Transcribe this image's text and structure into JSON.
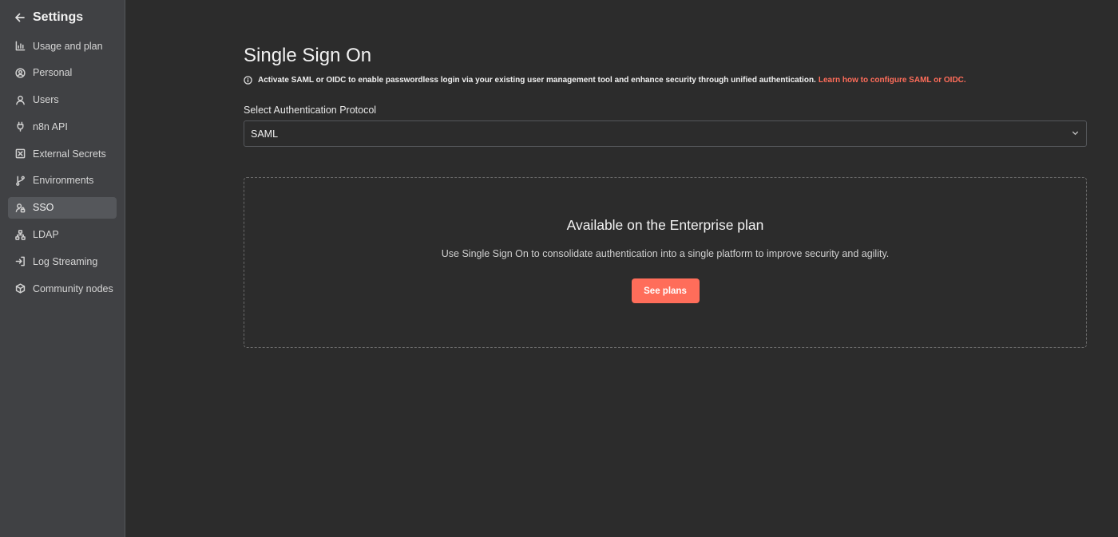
{
  "sidebar": {
    "title": "Settings",
    "items": [
      {
        "label": "Usage and plan",
        "icon": "chart-icon"
      },
      {
        "label": "Personal",
        "icon": "user-circle-icon"
      },
      {
        "label": "Users",
        "icon": "user-icon"
      },
      {
        "label": "n8n API",
        "icon": "plug-icon"
      },
      {
        "label": "External Secrets",
        "icon": "vault-icon"
      },
      {
        "label": "Environments",
        "icon": "git-branch-icon"
      },
      {
        "label": "SSO",
        "icon": "user-lock-icon",
        "active": true
      },
      {
        "label": "LDAP",
        "icon": "network-icon"
      },
      {
        "label": "Log Streaming",
        "icon": "sign-in-icon"
      },
      {
        "label": "Community nodes",
        "icon": "cube-icon"
      }
    ]
  },
  "main": {
    "title": "Single Sign On",
    "info_text": "Activate SAML or OIDC to enable passwordless login via your existing user management tool and enhance security through unified authentication.",
    "info_link": "Learn how to configure SAML or OIDC.",
    "protocol_label": "Select Authentication Protocol",
    "protocol_value": "SAML",
    "upsell": {
      "title": "Available on the Enterprise plan",
      "description": "Use Single Sign On to consolidate authentication into a single platform to improve security and agility.",
      "button": "See plans"
    }
  },
  "colors": {
    "accent": "#ff6d5a",
    "sidebar_bg": "#404144",
    "main_bg": "#2c2c2c",
    "active_item_bg": "#55575b"
  }
}
